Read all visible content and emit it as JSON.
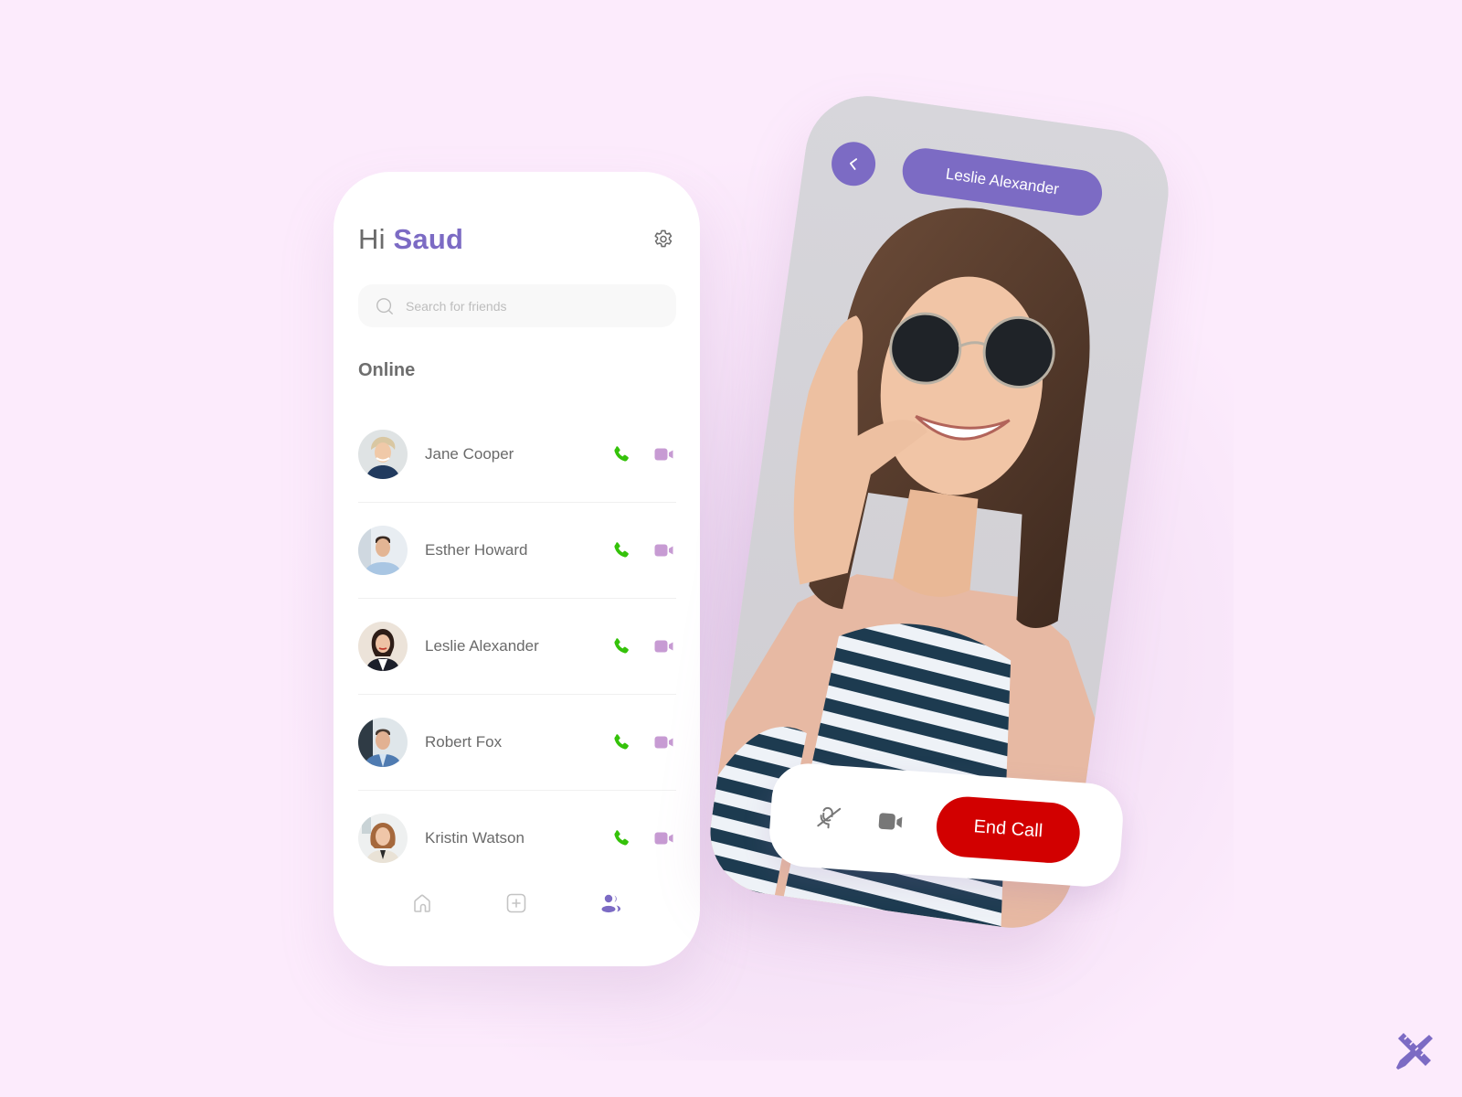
{
  "colors": {
    "accent": "#7c6bc4",
    "call_green": "#35c20a",
    "video_lilac": "#c79bd3",
    "end_call_red": "#d20000",
    "background": "#fcebfc"
  },
  "contacts_screen": {
    "greeting_prefix": "Hi",
    "user_name": "Saud",
    "settings_icon": "gear-icon",
    "search": {
      "placeholder": "Search for friends",
      "value": ""
    },
    "section_title": "Online",
    "contacts": [
      {
        "name": "Jane Cooper",
        "avatar": "avatar-jane-cooper",
        "call_icon": "phone-icon",
        "video_icon": "video-camera-icon"
      },
      {
        "name": "Esther Howard",
        "avatar": "avatar-esther-howard",
        "call_icon": "phone-icon",
        "video_icon": "video-camera-icon"
      },
      {
        "name": "Leslie Alexander",
        "avatar": "avatar-leslie-alexander",
        "call_icon": "phone-icon",
        "video_icon": "video-camera-icon"
      },
      {
        "name": "Robert Fox",
        "avatar": "avatar-robert-fox",
        "call_icon": "phone-icon",
        "video_icon": "video-camera-icon"
      },
      {
        "name": "Kristin Watson",
        "avatar": "avatar-kristin-watson",
        "call_icon": "phone-icon",
        "video_icon": "video-camera-icon"
      }
    ],
    "bottom_nav": [
      {
        "id": "home",
        "icon": "home-icon",
        "active": false
      },
      {
        "id": "add",
        "icon": "plus-square-icon",
        "active": false
      },
      {
        "id": "friends",
        "icon": "users-icon",
        "active": true
      }
    ]
  },
  "video_call_screen": {
    "back_icon": "chevron-left-icon",
    "caller_name": "Leslie Alexander",
    "controls": {
      "mute_icon": "microphone-off-icon",
      "camera_icon": "video-camera-icon",
      "end_call_label": "End Call"
    }
  },
  "brand_logo": "ruler-pencil-logo-icon"
}
